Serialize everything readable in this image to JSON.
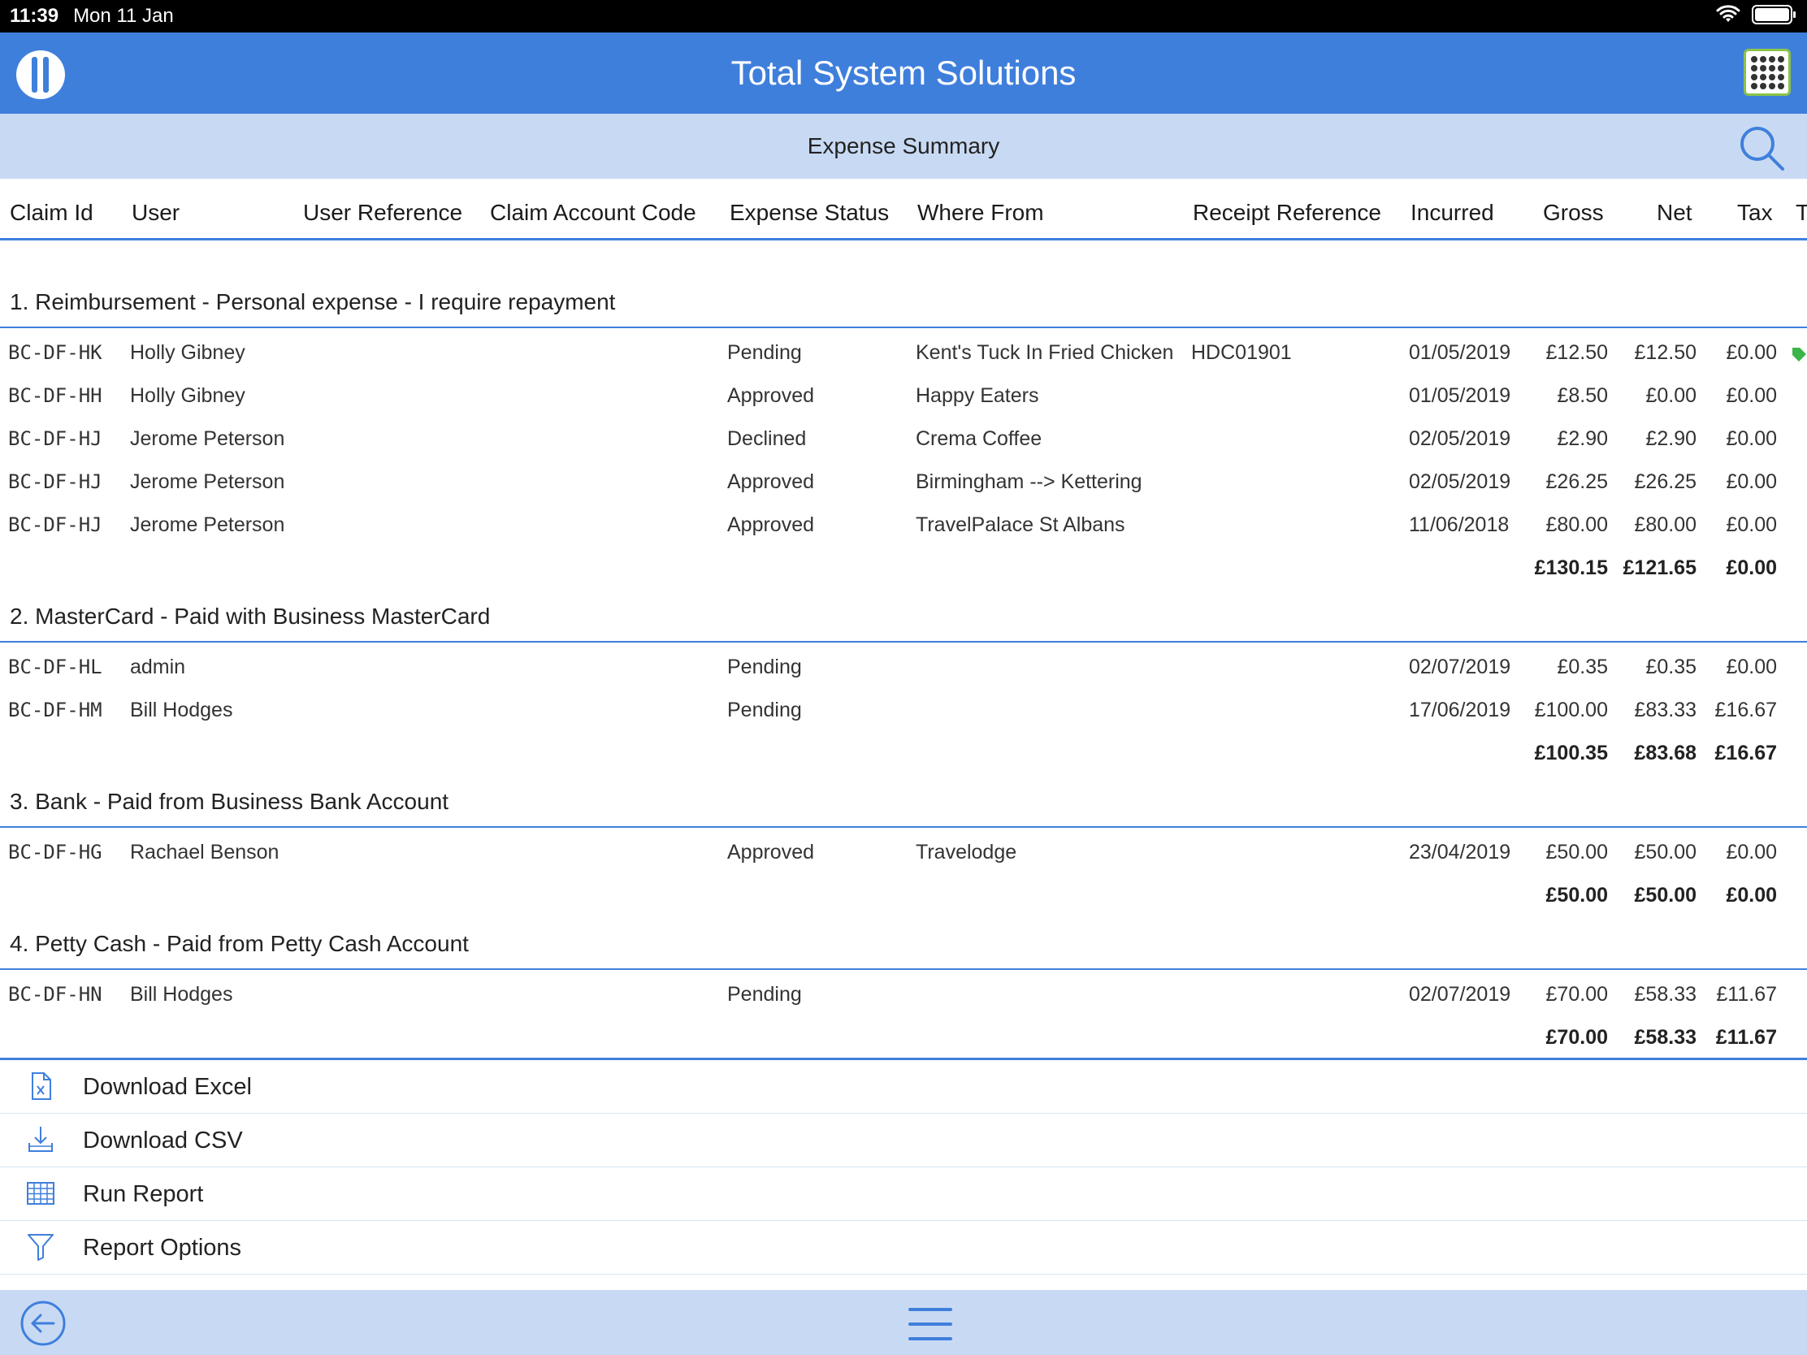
{
  "status_bar": {
    "time": "11:39",
    "date": "Mon 11 Jan",
    "battery_icon": "battery-icon",
    "wifi_icon": "wifi-icon"
  },
  "app": {
    "title": "Total System Solutions",
    "logo_icon": "logo-icon",
    "apps_icon": "apps-grid-icon"
  },
  "sub_header": {
    "title": "Expense Summary",
    "search_icon": "search-icon"
  },
  "columns": [
    "Claim Id",
    "User",
    "User Reference",
    "Claim Account Code",
    "Expense Status",
    "Where From",
    "Receipt Reference",
    "Incurred",
    "Gross",
    "Net",
    "Tax",
    "T"
  ],
  "sections": [
    {
      "title": "1. Reimbursement - Personal expense - I require repayment",
      "rows": [
        {
          "claim_id": "BC-DF-HK",
          "user": "Holly Gibney",
          "status": "Pending",
          "where_from": "Kent's Tuck In Fried Chicken",
          "receipt_ref": "HDC01901",
          "incurred": "01/05/2019",
          "gross": "£12.50",
          "net": "£12.50",
          "tax": "£0.00",
          "tagged": true
        },
        {
          "claim_id": "BC-DF-HH",
          "user": "Holly Gibney",
          "status": "Approved",
          "where_from": "Happy Eaters",
          "receipt_ref": "",
          "incurred": "01/05/2019",
          "gross": "£8.50",
          "net": "£0.00",
          "tax": "£0.00",
          "tagged": false
        },
        {
          "claim_id": "BC-DF-HJ",
          "user": "Jerome Peterson",
          "status": "Declined",
          "where_from": "Crema Coffee",
          "receipt_ref": "",
          "incurred": "02/05/2019",
          "gross": "£2.90",
          "net": "£2.90",
          "tax": "£0.00",
          "tagged": false
        },
        {
          "claim_id": "BC-DF-HJ",
          "user": "Jerome Peterson",
          "status": "Approved",
          "where_from": "Birmingham --> Kettering",
          "receipt_ref": "",
          "incurred": "02/05/2019",
          "gross": "£26.25",
          "net": "£26.25",
          "tax": "£0.00",
          "tagged": false
        },
        {
          "claim_id": "BC-DF-HJ",
          "user": "Jerome Peterson",
          "status": "Approved",
          "where_from": "TravelPalace St Albans",
          "receipt_ref": "",
          "incurred": "11/06/2018",
          "gross": "£80.00",
          "net": "£80.00",
          "tax": "£0.00",
          "tagged": false
        }
      ],
      "totals": {
        "gross": "£130.15",
        "net": "£121.65",
        "tax": "£0.00"
      }
    },
    {
      "title": "2. MasterCard - Paid with Business MasterCard",
      "rows": [
        {
          "claim_id": "BC-DF-HL",
          "user": "admin",
          "status": "Pending",
          "where_from": "",
          "receipt_ref": "",
          "incurred": "02/07/2019",
          "gross": "£0.35",
          "net": "£0.35",
          "tax": "£0.00",
          "tagged": false
        },
        {
          "claim_id": "BC-DF-HM",
          "user": "Bill Hodges",
          "status": "Pending",
          "where_from": "",
          "receipt_ref": "",
          "incurred": "17/06/2019",
          "gross": "£100.00",
          "net": "£83.33",
          "tax": "£16.67",
          "tagged": false
        }
      ],
      "totals": {
        "gross": "£100.35",
        "net": "£83.68",
        "tax": "£16.67"
      }
    },
    {
      "title": "3. Bank - Paid from Business Bank Account",
      "rows": [
        {
          "claim_id": "BC-DF-HG",
          "user": "Rachael Benson",
          "status": "Approved",
          "where_from": "Travelodge",
          "receipt_ref": "",
          "incurred": "23/04/2019",
          "gross": "£50.00",
          "net": "£50.00",
          "tax": "£0.00",
          "tagged": false
        }
      ],
      "totals": {
        "gross": "£50.00",
        "net": "£50.00",
        "tax": "£0.00"
      }
    },
    {
      "title": "4. Petty Cash - Paid from Petty Cash Account",
      "rows": [
        {
          "claim_id": "BC-DF-HN",
          "user": "Bill Hodges",
          "status": "Pending",
          "where_from": "",
          "receipt_ref": "",
          "incurred": "02/07/2019",
          "gross": "£70.00",
          "net": "£58.33",
          "tax": "£11.67",
          "tagged": false
        }
      ],
      "totals": {
        "gross": "£70.00",
        "net": "£58.33",
        "tax": "£11.67"
      }
    }
  ],
  "actions": [
    {
      "label": "Download Excel",
      "icon": "excel-file-icon"
    },
    {
      "label": "Download CSV",
      "icon": "download-icon"
    },
    {
      "label": "Run Report",
      "icon": "table-icon"
    },
    {
      "label": "Report Options",
      "icon": "filter-icon"
    }
  ],
  "footer": {
    "back_icon": "back-arrow-icon",
    "menu_icon": "hamburger-menu-icon"
  },
  "colors": {
    "brand_blue": "#3f7fdc",
    "light_blue": "#c8daf3",
    "tag_green": "#3bb54a"
  }
}
